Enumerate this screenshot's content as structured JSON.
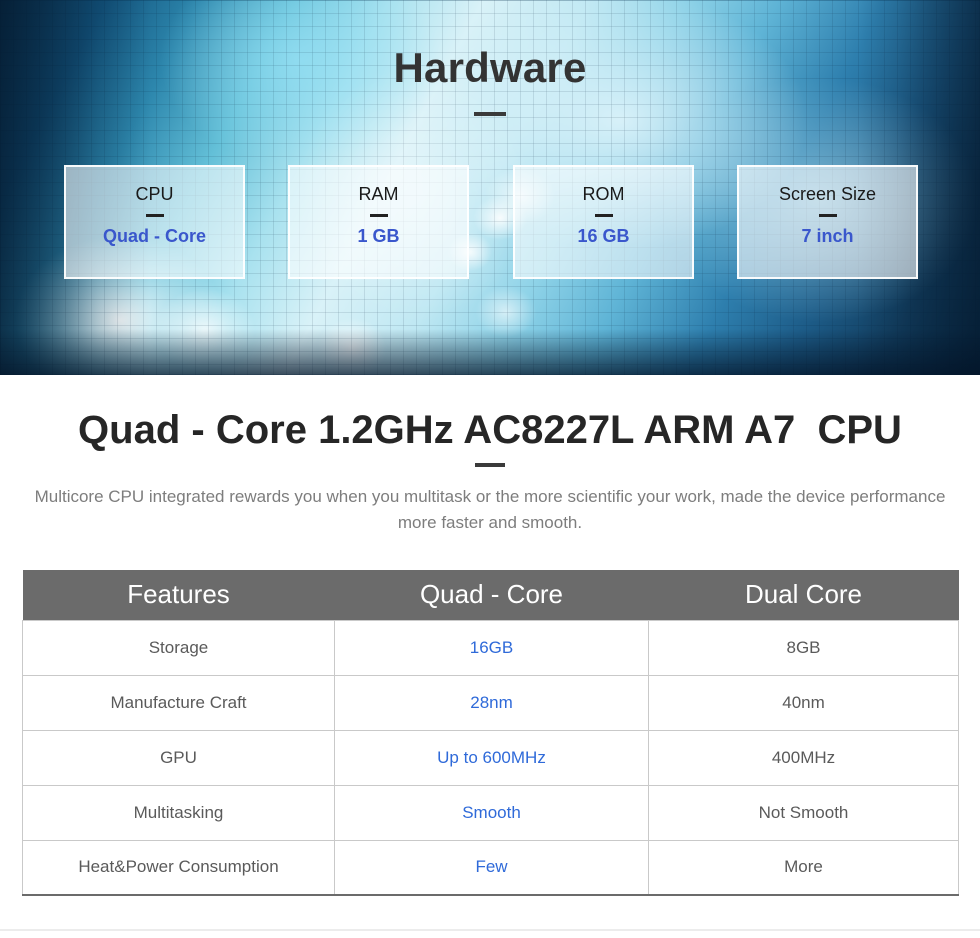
{
  "hero": {
    "title": "Hardware",
    "cards": [
      {
        "label": "CPU",
        "value": "Quad - Core"
      },
      {
        "label": "RAM",
        "value": "1 GB"
      },
      {
        "label": "ROM",
        "value": "16 GB"
      },
      {
        "label": "Screen Size",
        "value": "7 inch"
      }
    ]
  },
  "section": {
    "title": "Quad - Core 1.2GHz AC8227L ARM A7  CPU",
    "description": "Multicore CPU integrated rewards you when you multitask or the more scientific your work, made the device performance more faster and smooth."
  },
  "table": {
    "headers": [
      "Features",
      "Quad - Core",
      "Dual Core"
    ],
    "rows": [
      {
        "feature": "Storage",
        "quad": "16GB",
        "dual": "8GB"
      },
      {
        "feature": "Manufacture Craft",
        "quad": "28nm",
        "dual": "40nm"
      },
      {
        "feature": "GPU",
        "quad": "Up to 600MHz",
        "dual": "400MHz"
      },
      {
        "feature": "Multitasking",
        "quad": "Smooth",
        "dual": "Not Smooth"
      },
      {
        "feature": "Heat&Power Consumption",
        "quad": "Few",
        "dual": "More"
      }
    ]
  },
  "colors": {
    "hero_accent_blue": "#3a57cc",
    "table_accent_blue": "#2f6ad9",
    "table_header_gray": "#6b6b6b",
    "heading_dark": "#262626",
    "body_gray": "#7d7d7d"
  }
}
